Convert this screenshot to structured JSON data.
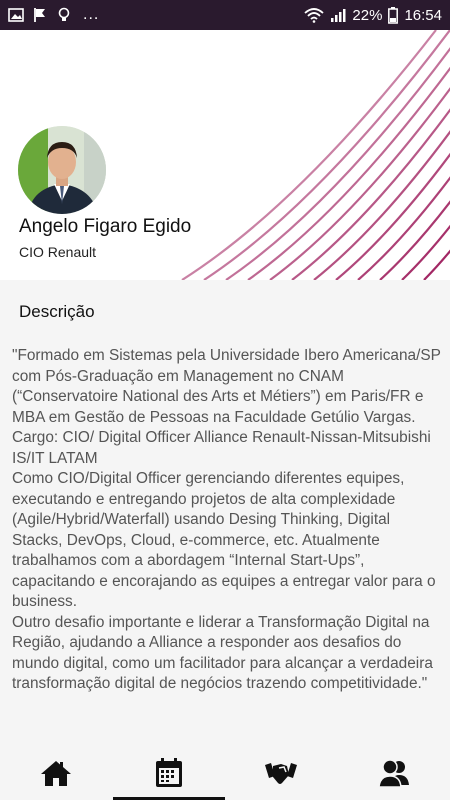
{
  "status_bar": {
    "left_icons": [
      "image-icon",
      "check-flag-icon",
      "lightbulb-icon"
    ],
    "more": "...",
    "right_icons": [
      "wifi-icon",
      "signal-icon",
      "battery-icon"
    ],
    "battery": "22%",
    "time": "16:54"
  },
  "profile": {
    "name": "Angelo Figaro Egido",
    "role": "CIO Renault",
    "accent_color": "#9c1a5a"
  },
  "section": {
    "title": "Descrição",
    "text": "\"Formado em Sistemas pela Universidade Ibero Americana/SP com Pós-Graduação em Management no CNAM (“Conservatoire National des Arts et Métiers”) em Paris/FR e MBA em Gestão de Pessoas na Faculdade Getúlio Vargas.\nCargo: CIO/ Digital Officer Alliance Renault-Nissan-Mitsubishi IS/IT LATAM\nComo CIO/Digital Officer gerenciando diferentes equipes, executando e entregando projetos de alta complexidade (Agile/Hybrid/Waterfall) usando Desing Thinking, Digital Stacks, DevOps, Cloud, e-commerce, etc. Atualmente trabalhamos com a abordagem “Internal Start-Ups”, capacitando e encorajando as equipes a entregar valor para o business.\nOutro desafio importante e liderar a Transformação Digital na Região, ajudando a Alliance a responder aos desafios do mundo digital, como um facilitador para alcançar a verdadeira transformação digital de negócios trazendo competitividade.\""
  },
  "bottom_nav": {
    "items": [
      {
        "icon": "home-icon",
        "active": false
      },
      {
        "icon": "calendar-icon",
        "active": true
      },
      {
        "icon": "handshake-icon",
        "active": false
      },
      {
        "icon": "people-icon",
        "active": false
      }
    ]
  }
}
